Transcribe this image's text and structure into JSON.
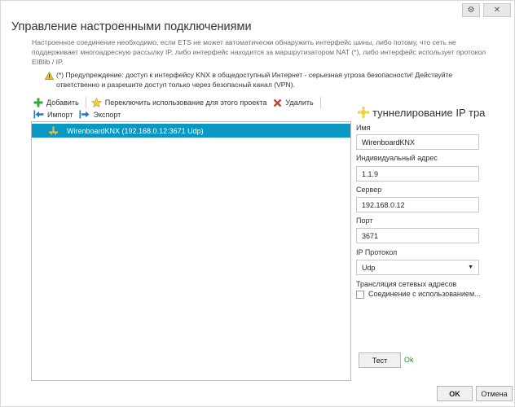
{
  "window": {
    "title": "Управление настроенными подключениями",
    "settings_icon": "gear-icon",
    "close_icon": "close-icon"
  },
  "description": "Настроенное соединение необходимо, если ETS не может автоматически обнаружить интерфейс шины, либо потому, что сеть не поддерживает многоадресную рассылку IP, либо интерфейс находится за маршрутизатором NAT (*), либо интерфейс использует протокол EIBlib / IP.",
  "warning": "(*) Предупреждение: доступ к интерфейсу KNX в общедоступный Интернет - серьезная угроза безопасности! Действуйте ответственно и разрешите доступ только через безопасный канал (VPN).",
  "toolbar": {
    "add": "Добавить",
    "switch": "Переключить использование для этого проекта",
    "delete": "Удалить",
    "import": "Импорт",
    "export": "Экспорт"
  },
  "connections": [
    {
      "label": "WirenboardKNX (192.168.0.12:3671 Udp)",
      "selected": true
    }
  ],
  "details": {
    "section_title": "туннелирование IP тра",
    "name_label": "Имя",
    "name_value": "WirenboardKNX",
    "ind_addr_label": "Индивидуальный адрес",
    "ind_addr_value": "1.1.9",
    "server_label": "Сервер",
    "server_value": "192.168.0.12",
    "port_label": "Порт",
    "port_value": "3671",
    "protocol_label": "IP Протокол",
    "protocol_value": "Udp",
    "nat_label": "Трансляция сетевых адресов",
    "nat_checkbox_label": "Соединение с использованием...",
    "nat_checked": false,
    "test_button": "Тест",
    "test_status": "Ok"
  },
  "footer": {
    "ok": "OK",
    "cancel": "Отмена"
  },
  "colors": {
    "selection": "#0b97c4",
    "status_ok": "#2e8b2e",
    "add_icon": "#3aa53a",
    "delete_icon": "#d23a2a",
    "star_icon": "#e8b820",
    "arrow_icon": "#2a73c6"
  }
}
